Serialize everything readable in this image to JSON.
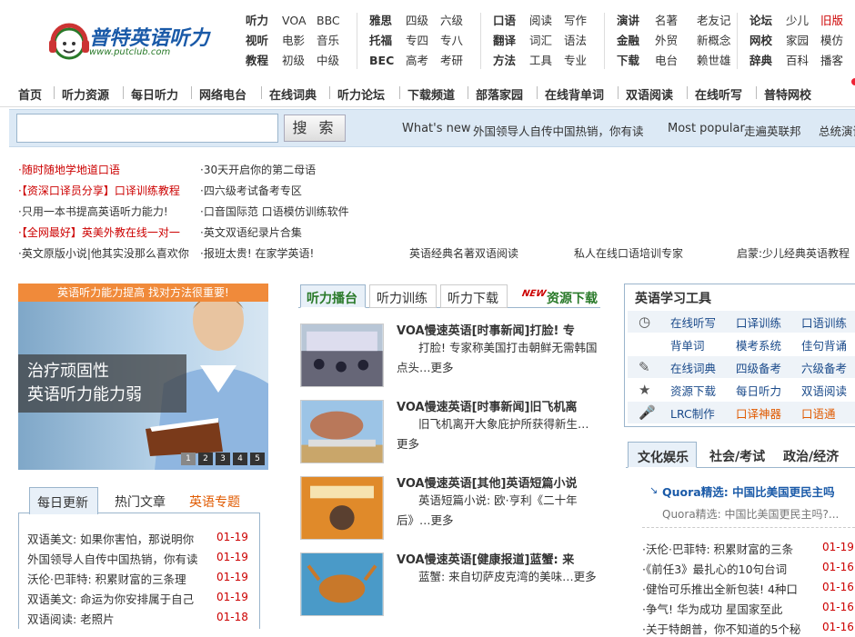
{
  "header": {
    "logo_text": "普特英语听力",
    "logo_url_text": "www.putclub.com",
    "link_groups": [
      {
        "rows": [
          [
            "听力",
            "VOA",
            "BBC"
          ],
          [
            "视听",
            "电影",
            "音乐"
          ],
          [
            "教程",
            "初级",
            "中级"
          ]
        ]
      },
      {
        "rows": [
          [
            "雅思",
            "四级",
            "六级"
          ],
          [
            "托福",
            "专四",
            "专八"
          ],
          [
            "BEC",
            "高考",
            "考研"
          ]
        ]
      },
      {
        "rows": [
          [
            "口语",
            "阅读",
            "写作"
          ],
          [
            "翻译",
            "词汇",
            "语法"
          ],
          [
            "方法",
            "工具",
            "专业"
          ]
        ]
      },
      {
        "rows": [
          [
            "演讲",
            "名著",
            "老友记"
          ],
          [
            "金融",
            "外贸",
            "新概念"
          ],
          [
            "下载",
            "电台",
            "赖世雄"
          ]
        ]
      },
      {
        "rows": [
          [
            "论坛",
            "少儿",
            "旧版"
          ],
          [
            "网校",
            "家园",
            "模仿"
          ],
          [
            "辞典",
            "百科",
            "播客"
          ]
        ]
      }
    ]
  },
  "nav": [
    "首页",
    "听力资源",
    "每日听力",
    "网络电台",
    "在线词典",
    "听力论坛",
    "下载频道",
    "部落家园",
    "在线背单词",
    "双语阅读",
    "在线听写",
    "普特网校"
  ],
  "search": {
    "placeholder": "",
    "button": "搜 索",
    "whats_new_label": "What's new",
    "whats_new_text": "外国领导人自传中国热销，你有读",
    "popular_label": "Most popular",
    "popular_text": "走遍英联邦",
    "trailing_text": "总统演讲"
  },
  "promo": {
    "left": [
      "·随时随地学地道口语",
      "·【资深口译员分享】口译训练教程",
      "·只用一本书提高英语听力能力!",
      "·【全网最好】英美外教在线一对一",
      "·英文原版小说|他其实没那么喜欢你"
    ],
    "right": [
      "·30天开启你的第二母语",
      "·四六级考试备考专区",
      "·口音国际范 口语模仿训练软件",
      "·英文双语纪录片合集",
      "·报班太贵! 在家学英语!"
    ],
    "extra": [
      "英语经典名著双语阅读",
      "私人在线口语培训专家",
      "启蒙:少儿经典英语教程"
    ]
  },
  "banner": {
    "top_text": "英语听力能力提高 找对方法很重要!",
    "line1": "治疗顽固性",
    "line2": "英语听力能力弱",
    "dots": [
      "1",
      "2",
      "3",
      "4",
      "5"
    ]
  },
  "left_tabs": [
    "每日更新",
    "热门文章",
    "英语专题"
  ],
  "daily": [
    {
      "title": "双语美文: 如果你害怕，那说明你",
      "date": "01-19"
    },
    {
      "title": "外国领导人自传中国热销，你有读",
      "date": "01-19"
    },
    {
      "title": "沃伦·巴菲特: 积累财富的三条理",
      "date": "01-19"
    },
    {
      "title": "双语美文: 命运为你安排属于自己",
      "date": "01-19"
    },
    {
      "title": "双语阅读: 老照片",
      "date": "01-18"
    }
  ],
  "mid_tabs": [
    "听力播台",
    "听力训练",
    "听力下载"
  ],
  "mid_new_badge": "NEW",
  "mid_download": "资源下载",
  "articles": [
    {
      "title": "VOA慢速英语[时事新闻]打脸! 专",
      "desc": "打脸! 专家称美国打击朝鲜无需韩国点头…更多"
    },
    {
      "title": "VOA慢速英语[时事新闻]旧飞机离",
      "desc": "旧飞机离开大象庇护所获得新生…更多"
    },
    {
      "title": "VOA慢速英语[其他]英语短篇小说",
      "desc": "英语短篇小说: 欧·亨利《二十年后》…更多"
    },
    {
      "title": "VOA慢速英语[健康报道]蓝蟹: 来",
      "desc": "蓝蟹: 来自切萨皮克湾的美味…更多"
    }
  ],
  "tools": {
    "title": "英语学习工具",
    "rows": [
      [
        "在线听写",
        "口译训练",
        "口语训练"
      ],
      [
        "背单词",
        "模考系统",
        "佳句背诵"
      ],
      [
        "在线词典",
        "四级备考",
        "六级备考"
      ],
      [
        "资源下载",
        "每日听力",
        "双语阅读"
      ],
      [
        "LRC制作",
        "口译神器",
        "口语通"
      ]
    ]
  },
  "right_tabs": [
    "文化娱乐",
    "社会/考试",
    "政治/经济"
  ],
  "quora": {
    "title": "Quora精选: 中国比美国更民主吗",
    "sub": "Quora精选: 中国比美国更民主吗?..."
  },
  "right_list": [
    {
      "title": "·沃伦·巴菲特: 积累财富的三条",
      "date": "01-19"
    },
    {
      "title": "·《前任3》最扎心的10句台词",
      "date": "01-16"
    },
    {
      "title": "·健怡可乐推出全新包装! 4种口",
      "date": "01-16"
    },
    {
      "title": "·争气! 华为成功 星国家至此",
      "date": "01-16"
    },
    {
      "title": "·关于特朗普，你不知道的5个秘",
      "date": "01-16"
    }
  ],
  "colors": {
    "accent_red": "#cc0000",
    "nav_blue_bg": "#dce9f5",
    "banner_orange": "#f08a3a",
    "tab_active_bg": "#e8f0f8"
  }
}
